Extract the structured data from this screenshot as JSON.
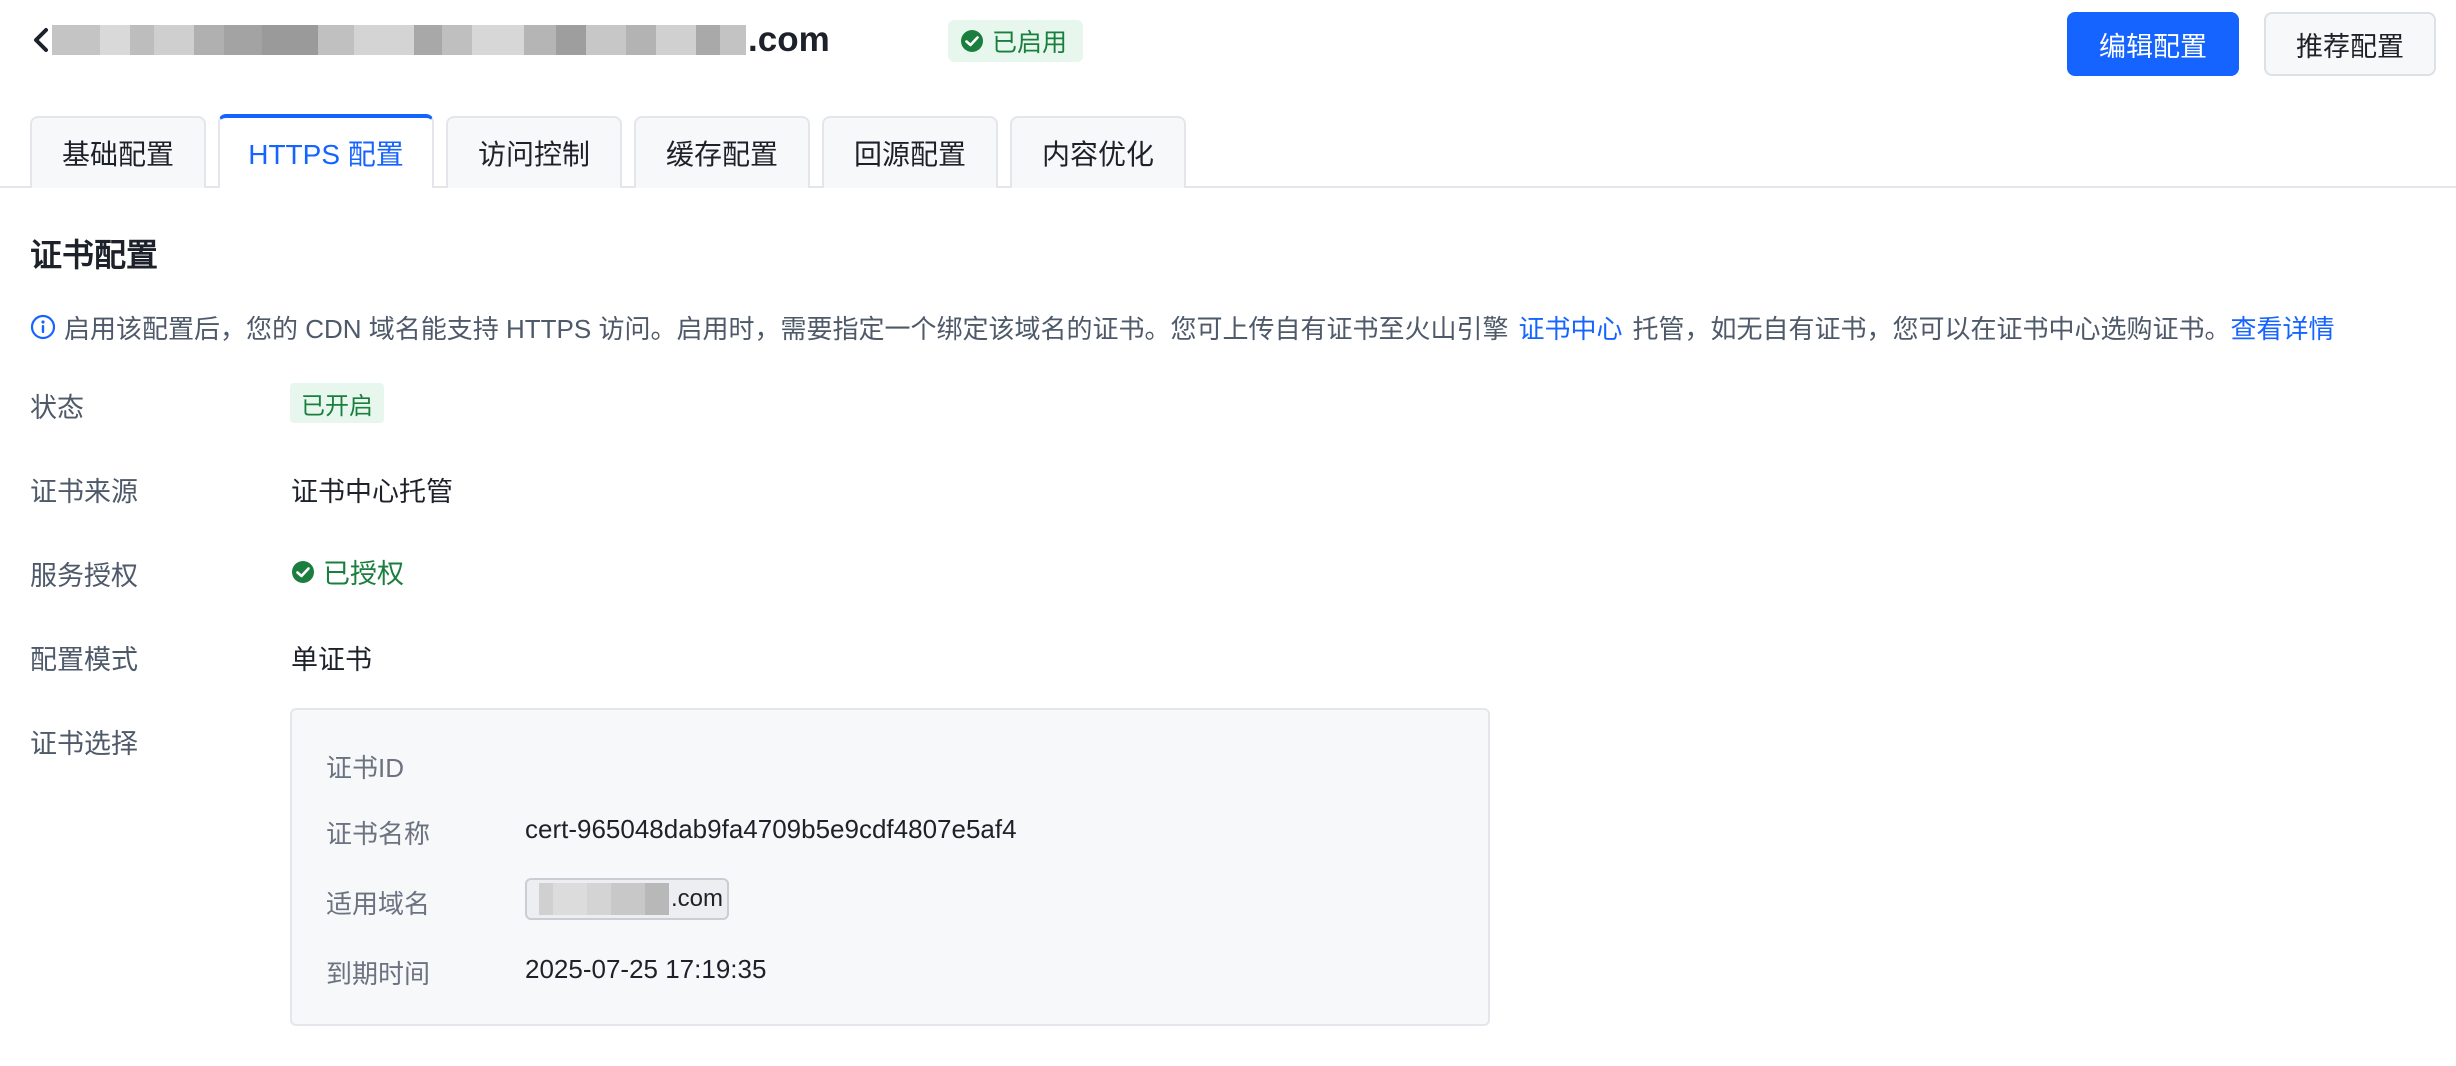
{
  "header": {
    "domain_visible_suffix": ".com",
    "status_badge": "已启用",
    "edit_button": "编辑配置",
    "recommend_button": "推荐配置"
  },
  "tabs": [
    {
      "label": "基础配置",
      "active": false
    },
    {
      "label": "HTTPS 配置",
      "active": true
    },
    {
      "label": "访问控制",
      "active": false
    },
    {
      "label": "缓存配置",
      "active": false
    },
    {
      "label": "回源配置",
      "active": false
    },
    {
      "label": "内容优化",
      "active": false
    }
  ],
  "section": {
    "title": "证书配置",
    "info_text_1": "启用该配置后，您的 CDN 域名能支持 HTTPS 访问。启用时，需要指定一个绑定该域名的证书。您可上传自有证书至火山引擎",
    "info_link_1": "证书中心",
    "info_text_2": "托管，如无自有证书，您可以在证书中心选购证书。",
    "info_link_2": "查看详情"
  },
  "fields": {
    "status_label": "状态",
    "status_value": "已开启",
    "source_label": "证书来源",
    "source_value": "证书中心托管",
    "auth_label": "服务授权",
    "auth_value": "已授权",
    "mode_label": "配置模式",
    "mode_value": "单证书",
    "select_label": "证书选择"
  },
  "certificate": {
    "id_label": "证书ID",
    "name_label": "证书名称",
    "name_value": "cert-965048dab9fa4709b5e9cdf4807e5af4",
    "domain_label": "适用域名",
    "domain_visible_suffix": ".com",
    "expiry_label": "到期时间",
    "expiry_value": "2025-07-25 17:19:35"
  },
  "colors": {
    "primary": "#1664ff",
    "success": "#1a7f3e",
    "success_bg": "#e8f7ee",
    "border": "#e5e6eb"
  }
}
